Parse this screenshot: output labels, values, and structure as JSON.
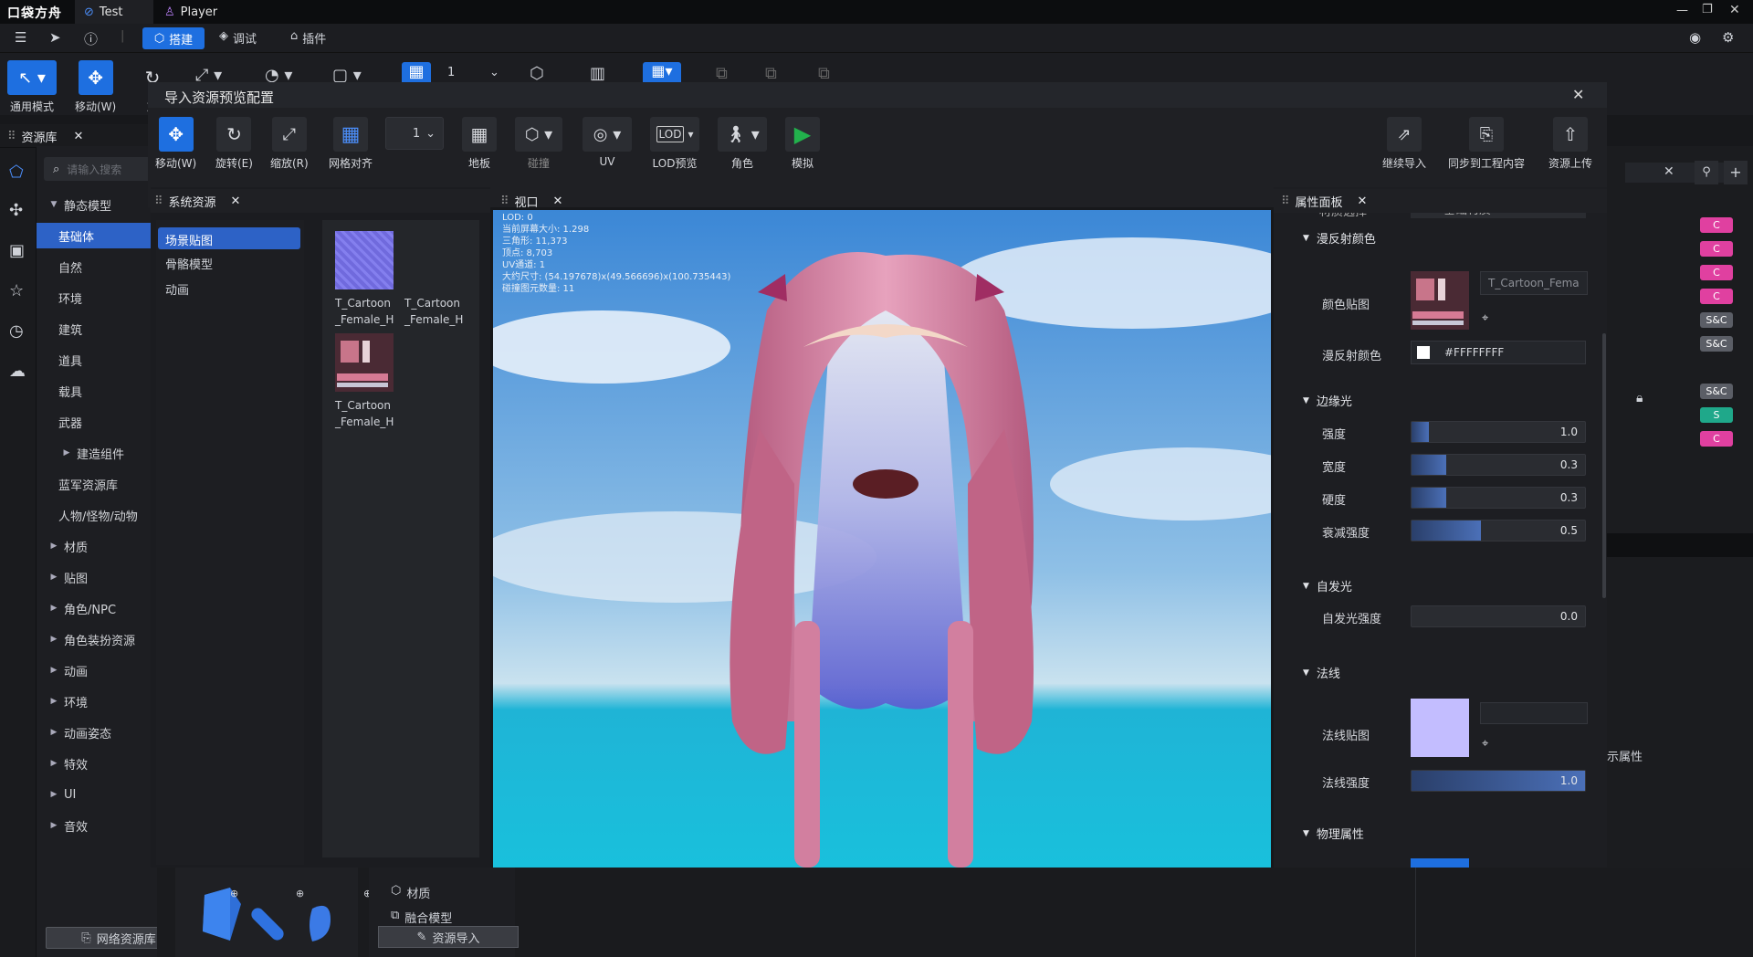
{
  "titlebar": {
    "logo": "口袋方舟",
    "tabs": [
      {
        "label": "Test"
      },
      {
        "label": "Player"
      }
    ]
  },
  "menubar": {
    "modes": [
      {
        "label": "搭建"
      },
      {
        "label": "调试"
      },
      {
        "label": "插件"
      }
    ]
  },
  "main_toolbar": {
    "items": [
      {
        "label": "通用模式"
      },
      {
        "label": "移动(W)"
      },
      {
        "label": "旋"
      }
    ],
    "grid_value": "1"
  },
  "dialog": {
    "title": "导入资源预览配置",
    "tools": [
      {
        "label": "移动(W)"
      },
      {
        "label": "旋转(E)"
      },
      {
        "label": "缩放(R)"
      },
      {
        "label": "网格对齐"
      },
      {
        "label": "地板"
      },
      {
        "label": "碰撞"
      },
      {
        "label": "UV"
      },
      {
        "label": "LOD预览"
      },
      {
        "label": "角色"
      },
      {
        "label": "模拟"
      }
    ],
    "grid_select_value": "1",
    "right_actions": [
      {
        "label": "继续导入"
      },
      {
        "label": "同步到工程内容"
      },
      {
        "label": "资源上传"
      }
    ]
  },
  "asset_library": {
    "tab_label": "资源库",
    "search_placeholder": "请输入搜索",
    "tree": [
      {
        "label": "静态模型",
        "caret": "▼"
      },
      {
        "label": "基础体",
        "caret": ""
      },
      {
        "label": "自然",
        "caret": ""
      },
      {
        "label": "环境",
        "caret": ""
      },
      {
        "label": "建筑",
        "caret": ""
      },
      {
        "label": "道具",
        "caret": ""
      },
      {
        "label": "载具",
        "caret": ""
      },
      {
        "label": "武器",
        "caret": ""
      },
      {
        "label": "建造组件",
        "caret": "▶"
      },
      {
        "label": "蓝军资源库",
        "caret": ""
      },
      {
        "label": "人物/怪物/动物",
        "caret": ""
      },
      {
        "label": "材质",
        "caret": "▶"
      },
      {
        "label": "贴图",
        "caret": "▶"
      },
      {
        "label": "角色/NPC",
        "caret": "▶"
      },
      {
        "label": "角色装扮资源",
        "caret": "▶"
      },
      {
        "label": "动画",
        "caret": "▶"
      },
      {
        "label": "环境",
        "caret": "▶"
      },
      {
        "label": "动画姿态",
        "caret": "▶"
      },
      {
        "label": "特效",
        "caret": "▶"
      },
      {
        "label": "UI",
        "caret": "▶"
      },
      {
        "label": "音效",
        "caret": "▶"
      }
    ],
    "footer_button": "网络资源库"
  },
  "system_resources": {
    "tab_label": "系统资源",
    "categories": [
      {
        "label": "场景贴图"
      },
      {
        "label": "骨骼模型"
      },
      {
        "label": "动画"
      }
    ],
    "assets": [
      {
        "line1": "T_Cartoon",
        "line2": "_Female_H"
      },
      {
        "line1": "T_Cartoon",
        "line2": "_Female_H"
      },
      {
        "line1": "T_Cartoon",
        "line2": "_Female_H"
      }
    ]
  },
  "viewport": {
    "tab_label": "视口",
    "stats": [
      "LOD:  0",
      "当前屏幕大小: 1.298",
      "三角形: 11,373",
      "顶点: 8,703",
      "UV通道: 1",
      "大约尺寸: (54.197678)x(49.566696)x(100.735443)",
      "碰撞图元数量: 11"
    ]
  },
  "properties": {
    "tab_label": "属性面板",
    "top_label": "材质选择",
    "top_value": "基础材质",
    "diffuse": {
      "title": "漫反射颜色",
      "texture_label": "颜色贴图",
      "texture_name": "T_Cartoon_Fema",
      "color_label": "漫反射颜色",
      "color_value": "#FFFFFFFF"
    },
    "rim": {
      "title": "边缘光",
      "rows": [
        {
          "label": "强度",
          "value": "1.0",
          "fill": 0.1
        },
        {
          "label": "宽度",
          "value": "0.3",
          "fill": 0.2
        },
        {
          "label": "硬度",
          "value": "0.3",
          "fill": 0.2
        },
        {
          "label": "衰减强度",
          "value": "0.5",
          "fill": 0.4
        }
      ]
    },
    "emissive": {
      "title": "自发光",
      "label": "自发光强度",
      "value": "0.0",
      "fill": 0
    },
    "normal": {
      "title": "法线",
      "texture_label": "法线贴图",
      "strength_label": "法线强度",
      "strength_value": "1.0",
      "fill": 1.0
    },
    "physics": {
      "title": "物理属性"
    }
  },
  "right_panel": {
    "badges": [
      {
        "label": "C",
        "color": "#e040a0"
      },
      {
        "label": "C",
        "color": "#e040a0"
      },
      {
        "label": "C",
        "color": "#e040a0"
      },
      {
        "label": "C",
        "color": "#e040a0"
      },
      {
        "label": "S&C",
        "color": "#5b5e66"
      },
      {
        "label": "S&C",
        "color": "#5b5e66"
      },
      {
        "label": "S&C",
        "color": "#5b5e66"
      },
      {
        "label": "S",
        "color": "#1fa88a"
      },
      {
        "label": "C",
        "color": "#e040a0"
      }
    ],
    "show_props_label": "示属性"
  },
  "bottom": {
    "list_items": [
      {
        "label": "材质"
      },
      {
        "label": "融合模型"
      }
    ],
    "import_button": "资源导入"
  },
  "colors": {
    "accent": "#1e6fe0",
    "selection": "#2d62c6",
    "play": "#22b14c"
  }
}
